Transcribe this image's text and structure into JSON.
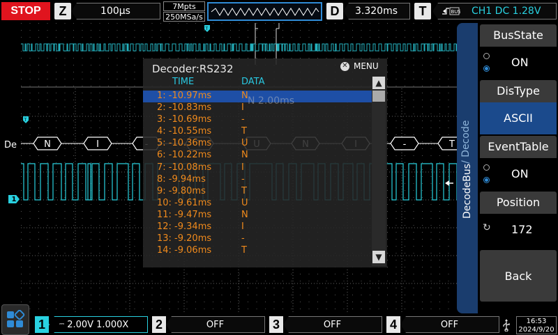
{
  "topbar": {
    "run_state": "STOP",
    "zoom_key": "Z",
    "timebase": "100µs",
    "memory_depth": "7Mpts",
    "sample_rate": "250MSa/s",
    "delay_key": "D",
    "delay": "3.320ms",
    "trigger_key": "T",
    "trigger_info": "CH1 DC 1.28V"
  },
  "waveform": {
    "bus_label": "De",
    "channel_marker": "1",
    "trigger_marker": "T",
    "bus_chars": [
      "N",
      "I",
      "-",
      "T",
      "U",
      "N",
      "I",
      "-",
      "T"
    ],
    "faded_overlay": "N  2.00ms"
  },
  "decoder": {
    "title": "Decoder:RS232",
    "menu_label": "MENU",
    "col_time": "TIME",
    "col_data": "DATA",
    "rows": [
      {
        "time": "1: -10.97ms",
        "data": "N"
      },
      {
        "time": "2: -10.83ms",
        "data": "I"
      },
      {
        "time": "3: -10.69ms",
        "data": "-"
      },
      {
        "time": "4: -10.55ms",
        "data": "T"
      },
      {
        "time": "5: -10.36ms",
        "data": "U"
      },
      {
        "time": "6: -10.22ms",
        "data": "N"
      },
      {
        "time": "7: -10.08ms",
        "data": "I"
      },
      {
        "time": "8: -9.94ms",
        "data": "-"
      },
      {
        "time": "9: -9.80ms",
        "data": "T"
      },
      {
        "time": "10: -9.61ms",
        "data": "U"
      },
      {
        "time": "11: -9.47ms",
        "data": "N"
      },
      {
        "time": "12: -9.34ms",
        "data": "I"
      },
      {
        "time": "13: -9.20ms",
        "data": "-"
      },
      {
        "time": "14: -9.06ms",
        "data": "T"
      }
    ],
    "selected_row": 0
  },
  "sidemenu": {
    "tab_label": "DecodeBus",
    "tab_sublabel": "/ Decode",
    "items": [
      {
        "label": "BusState",
        "value": "ON"
      },
      {
        "label": "DisType",
        "value": "ASCII"
      },
      {
        "label": "EventTable",
        "value": "ON"
      },
      {
        "label": "Position",
        "value": "172"
      }
    ],
    "back_label": "Back"
  },
  "bottombar": {
    "ch1": {
      "num": "1",
      "setting": "2.00V 1.000X"
    },
    "ch2": {
      "num": "2",
      "setting": "OFF"
    },
    "ch3": {
      "num": "3",
      "setting": "OFF"
    },
    "ch4": {
      "num": "4",
      "setting": "OFF"
    },
    "time": "16:53",
    "date": "2024/9/20"
  },
  "colors": {
    "ch1": "#29d1e0",
    "accent": "#2f8bd6",
    "stop": "#e0141e",
    "decode_text": "#f08a1c"
  }
}
